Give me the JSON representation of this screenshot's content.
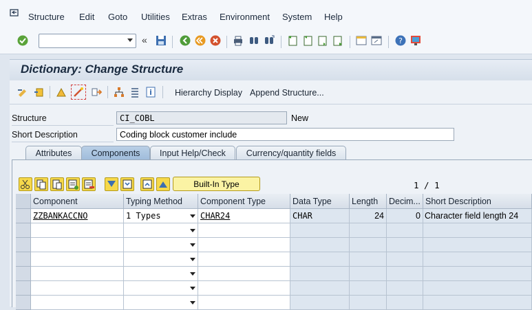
{
  "menu": {
    "items": [
      {
        "label": "Structure"
      },
      {
        "label": "Edit"
      },
      {
        "label": "Goto"
      },
      {
        "label": "Utilities"
      },
      {
        "label": "Extras"
      },
      {
        "label": "Environment"
      },
      {
        "label": "System"
      },
      {
        "label": "Help"
      }
    ]
  },
  "toolbar": {
    "command_field_value": ""
  },
  "title": "Dictionary: Change Structure",
  "app_toolbar": {
    "hierarchy_label": "Hierarchy Display",
    "append_label": "Append Structure..."
  },
  "form": {
    "structure_label": "Structure",
    "structure_value": "CI_COBL",
    "status": "New",
    "short_desc_label": "Short Description",
    "short_desc_value": "Coding block customer include"
  },
  "tabs": [
    {
      "label": "Attributes",
      "active": false
    },
    {
      "label": "Components",
      "active": true
    },
    {
      "label": "Input Help/Check",
      "active": false
    },
    {
      "label": "Currency/quantity fields",
      "active": false
    }
  ],
  "grid_toolbar": {
    "builtin_label": "Built-In Type",
    "pager": "1  /  1"
  },
  "grid": {
    "columns": [
      "Component",
      "Typing Method",
      "Component Type",
      "Data Type",
      "Length",
      "Decim...",
      "Short Description"
    ],
    "rows": [
      {
        "component": "ZZBANKACCNO",
        "typing": "1 Types",
        "comp_type": "CHAR24",
        "data_type": "CHAR",
        "length": "24",
        "decimals": "0",
        "short_desc": "Character field length 24"
      }
    ]
  },
  "colors": {
    "accent": "#9fbcdb",
    "highlight_button": "#fbf3a4"
  }
}
